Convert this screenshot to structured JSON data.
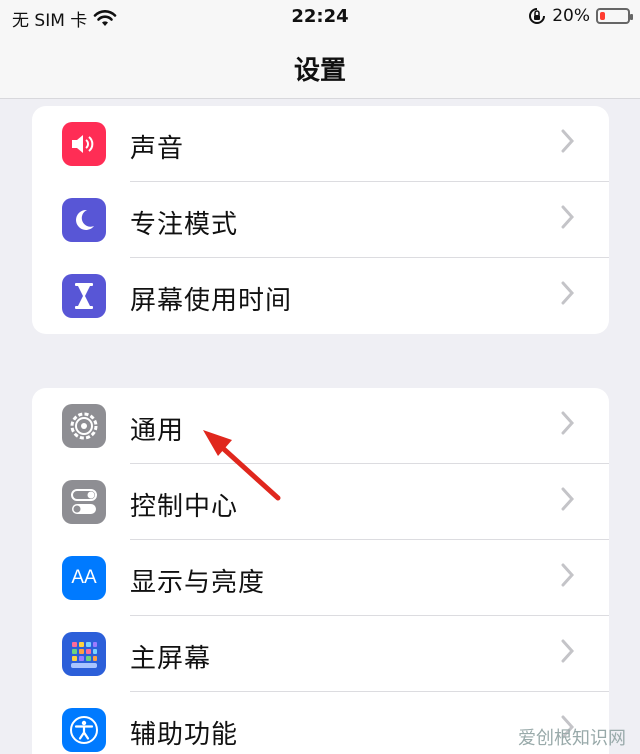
{
  "status": {
    "carrier": "无 SIM 卡",
    "time": "22:24",
    "battery_percent": "20%",
    "battery_level": 0.2
  },
  "nav": {
    "title": "设置"
  },
  "group1": [
    {
      "label": "声音",
      "icon": "speaker-icon",
      "color": "#ff2d55"
    },
    {
      "label": "专注模式",
      "icon": "moon-icon",
      "color": "#5856d6"
    },
    {
      "label": "屏幕使用时间",
      "icon": "hourglass-icon",
      "color": "#5856d6"
    }
  ],
  "group2": [
    {
      "label": "通用",
      "icon": "gear-icon",
      "color": "#8e8e93"
    },
    {
      "label": "控制中心",
      "icon": "toggles-icon",
      "color": "#8e8e93"
    },
    {
      "label": "显示与亮度",
      "icon": "aa-icon",
      "icon_text": "AA",
      "color": "#007aff"
    },
    {
      "label": "主屏幕",
      "icon": "grid-icon",
      "color": "#2c5fd9"
    },
    {
      "label": "辅助功能",
      "icon": "accessibility-icon",
      "color": "#007aff"
    }
  ],
  "watermark": "爱创根知识网"
}
